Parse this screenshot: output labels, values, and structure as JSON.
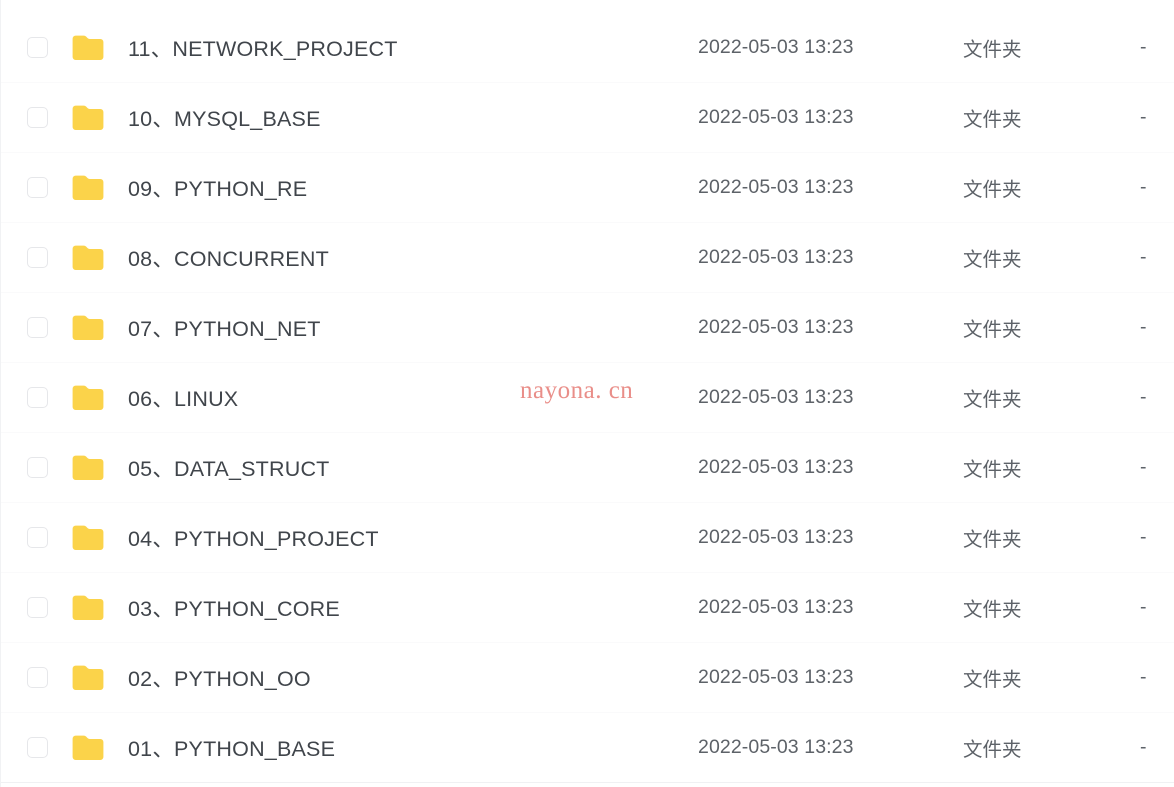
{
  "watermark": {
    "text": "nayona. cn",
    "color": "#e8857f"
  },
  "theme": {
    "folder_icon_color": "#fbd34a",
    "name_text_color": "#40454b",
    "meta_text_color": "#5d6268",
    "checkbox_border_color": "#e6e7ea",
    "row_divider_color": "#f0f1f3",
    "background": "#ffffff"
  },
  "columns": {
    "name": "",
    "modified": "",
    "type": "",
    "size": ""
  },
  "rows": [
    {
      "icon": "folder-icon",
      "name": "11、NETWORK_PROJECT",
      "modified": "2022-05-03 13:23",
      "type": "文件夹",
      "size": "-",
      "checked": false
    },
    {
      "icon": "folder-icon",
      "name": "10、MYSQL_BASE",
      "modified": "2022-05-03 13:23",
      "type": "文件夹",
      "size": "-",
      "checked": false
    },
    {
      "icon": "folder-icon",
      "name": "09、PYTHON_RE",
      "modified": "2022-05-03 13:23",
      "type": "文件夹",
      "size": "-",
      "checked": false
    },
    {
      "icon": "folder-icon",
      "name": "08、CONCURRENT",
      "modified": "2022-05-03 13:23",
      "type": "文件夹",
      "size": "-",
      "checked": false
    },
    {
      "icon": "folder-icon",
      "name": "07、PYTHON_NET",
      "modified": "2022-05-03 13:23",
      "type": "文件夹",
      "size": "-",
      "checked": false
    },
    {
      "icon": "folder-icon",
      "name": "06、LINUX",
      "modified": "2022-05-03 13:23",
      "type": "文件夹",
      "size": "-",
      "checked": false
    },
    {
      "icon": "folder-icon",
      "name": "05、DATA_STRUCT",
      "modified": "2022-05-03 13:23",
      "type": "文件夹",
      "size": "-",
      "checked": false
    },
    {
      "icon": "folder-icon",
      "name": "04、PYTHON_PROJECT",
      "modified": "2022-05-03 13:23",
      "type": "文件夹",
      "size": "-",
      "checked": false
    },
    {
      "icon": "folder-icon",
      "name": "03、PYTHON_CORE",
      "modified": "2022-05-03 13:23",
      "type": "文件夹",
      "size": "-",
      "checked": false
    },
    {
      "icon": "folder-icon",
      "name": "02、PYTHON_OO",
      "modified": "2022-05-03 13:23",
      "type": "文件夹",
      "size": "-",
      "checked": false
    },
    {
      "icon": "folder-icon",
      "name": "01、PYTHON_BASE",
      "modified": "2022-05-03 13:23",
      "type": "文件夹",
      "size": "-",
      "checked": false
    }
  ]
}
